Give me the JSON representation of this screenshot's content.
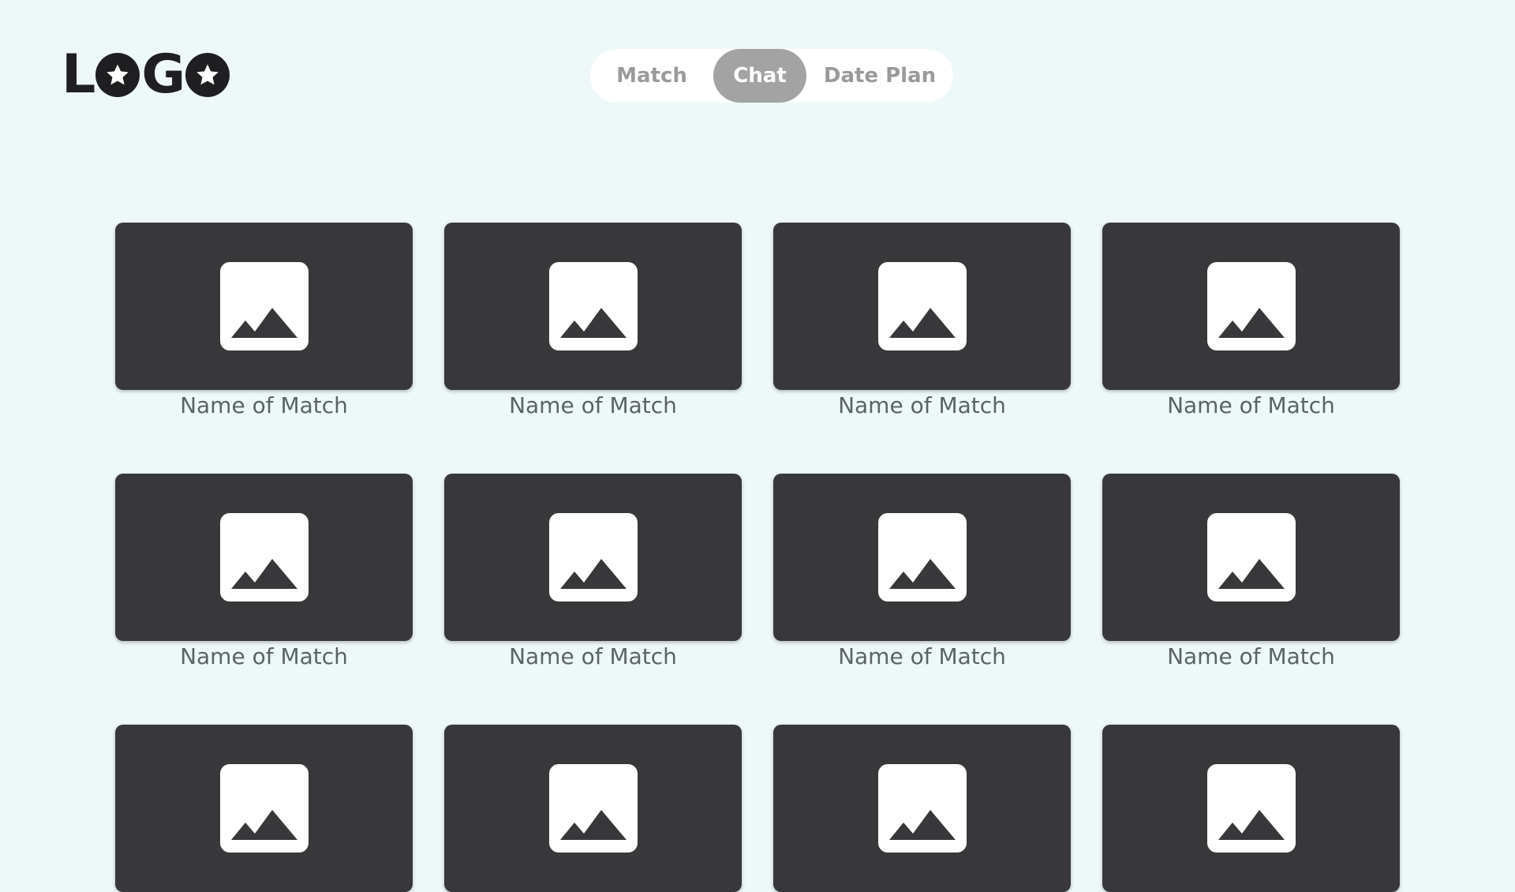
{
  "logo": {
    "letters": [
      "L",
      "G"
    ]
  },
  "nav": {
    "tabs": [
      {
        "label": "Match",
        "active": false
      },
      {
        "label": "Chat",
        "active": true
      },
      {
        "label": "Date Plan",
        "active": false
      }
    ]
  },
  "matches": [
    {
      "name": "Name of Match",
      "icon": "image-icon"
    },
    {
      "name": "Name of Match",
      "icon": "image-icon"
    },
    {
      "name": "Name of Match",
      "icon": "image-icon"
    },
    {
      "name": "Name of Match",
      "icon": "image-icon"
    },
    {
      "name": "Name of Match",
      "icon": "image-icon"
    },
    {
      "name": "Name of Match",
      "icon": "image-icon"
    },
    {
      "name": "Name of Match",
      "icon": "image-icon"
    },
    {
      "name": "Name of Match",
      "icon": "image-icon"
    },
    {
      "name": "",
      "icon": "image-icon"
    },
    {
      "name": "",
      "icon": "image-icon"
    },
    {
      "name": "",
      "icon": "image-icon"
    },
    {
      "name": "",
      "icon": "image-icon"
    }
  ],
  "colors": {
    "background": "#eef8f9",
    "card": "#38383a",
    "active_tab": "#a3a3a3"
  }
}
